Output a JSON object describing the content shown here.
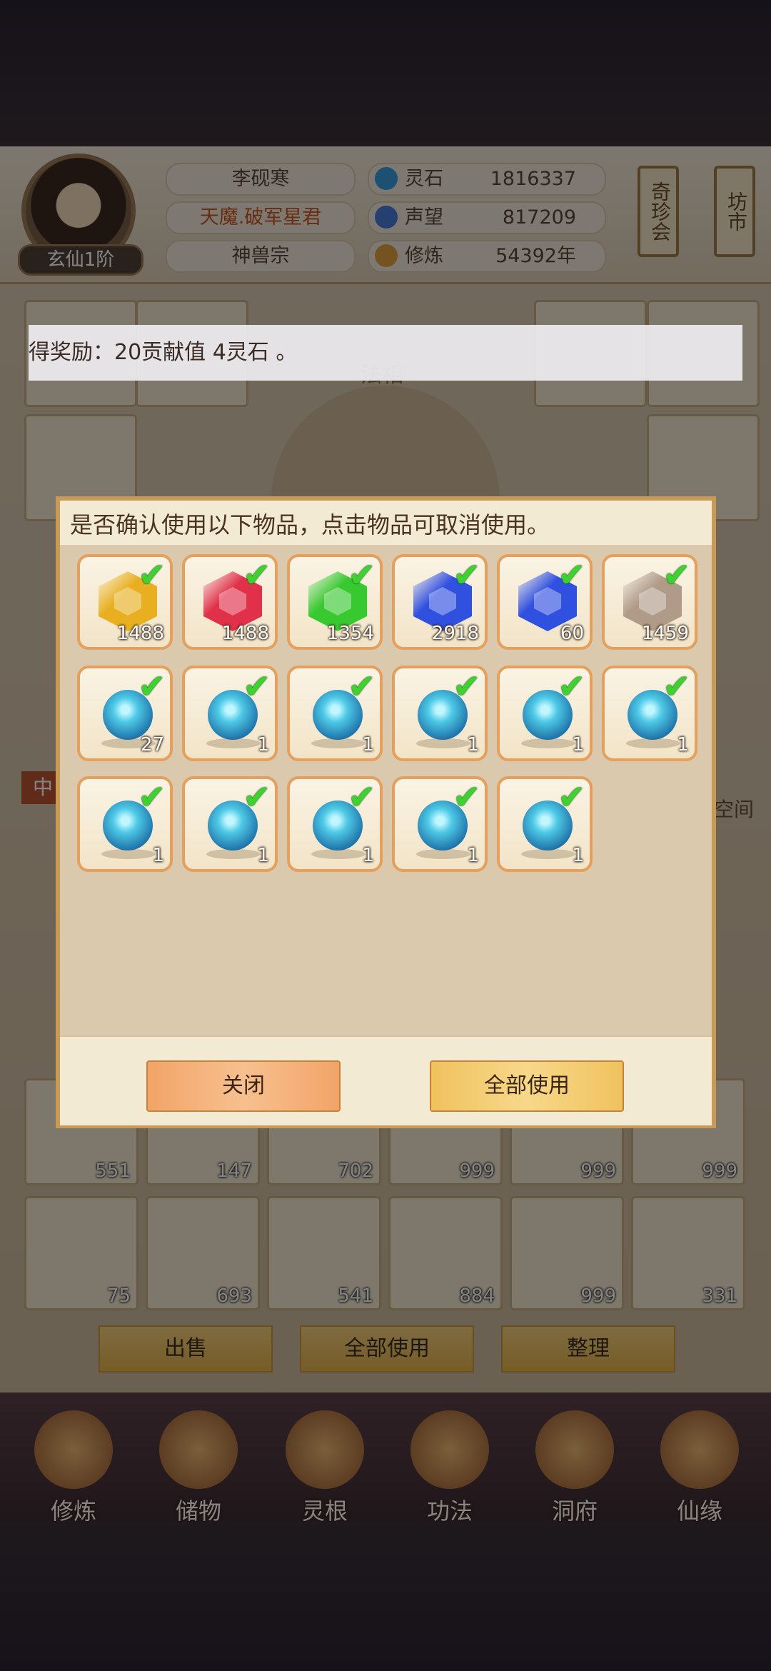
{
  "player": {
    "name": "李砚寒",
    "title": "天魔.破军星君",
    "sect": "神兽宗",
    "rank": "玄仙1阶"
  },
  "stats": [
    {
      "label": "灵石",
      "value": "1816337",
      "icon": "spirit-stone-icon",
      "color": "#3a9ad8"
    },
    {
      "label": "声望",
      "value": "817209",
      "icon": "reputation-icon",
      "color": "#4a7ad8"
    },
    {
      "label": "修炼",
      "value": "54392年",
      "icon": "cultivation-icon",
      "color": "#e0a040"
    }
  ],
  "side_badges": [
    {
      "label": "奇珍会"
    },
    {
      "label": "坊市"
    }
  ],
  "toast": "得奖励：20贡献值 4灵石 。",
  "background_labels": {
    "fa_xiang": "法相",
    "space": "空间",
    "tab_partial": "中"
  },
  "bag_counts_row1": [
    "551",
    "147",
    "702",
    "999",
    "999",
    "999"
  ],
  "bag_counts_row2": [
    "75",
    "693",
    "541",
    "884",
    "999",
    "331"
  ],
  "bag_buttons": {
    "sell": "出售",
    "use_all": "全部使用",
    "sort": "整理"
  },
  "nav": [
    "修炼",
    "储物",
    "灵根",
    "功法",
    "洞府",
    "仙缘"
  ],
  "dialog": {
    "title": "是否确认使用以下物品，点击物品可取消使用。",
    "close_label": "关闭",
    "use_all_label": "全部使用",
    "items": [
      {
        "type": "gem",
        "color": "#e8b020",
        "count": "1488"
      },
      {
        "type": "gem",
        "color": "#e0304a",
        "count": "1488"
      },
      {
        "type": "gem",
        "color": "#38c830",
        "count": "1354"
      },
      {
        "type": "gem",
        "color": "#3050e0",
        "count": "2918"
      },
      {
        "type": "gem",
        "color": "#3050e0",
        "count": "60"
      },
      {
        "type": "gem",
        "color": "#b09a88",
        "count": "1459"
      },
      {
        "type": "orb",
        "count": "27"
      },
      {
        "type": "orb",
        "count": "1"
      },
      {
        "type": "orb",
        "count": "1"
      },
      {
        "type": "orb",
        "count": "1"
      },
      {
        "type": "orb",
        "count": "1"
      },
      {
        "type": "orb",
        "count": "1"
      },
      {
        "type": "orb",
        "count": "1"
      },
      {
        "type": "orb",
        "count": "1"
      },
      {
        "type": "orb",
        "count": "1"
      },
      {
        "type": "orb",
        "count": "1"
      },
      {
        "type": "orb",
        "count": "1"
      }
    ]
  }
}
